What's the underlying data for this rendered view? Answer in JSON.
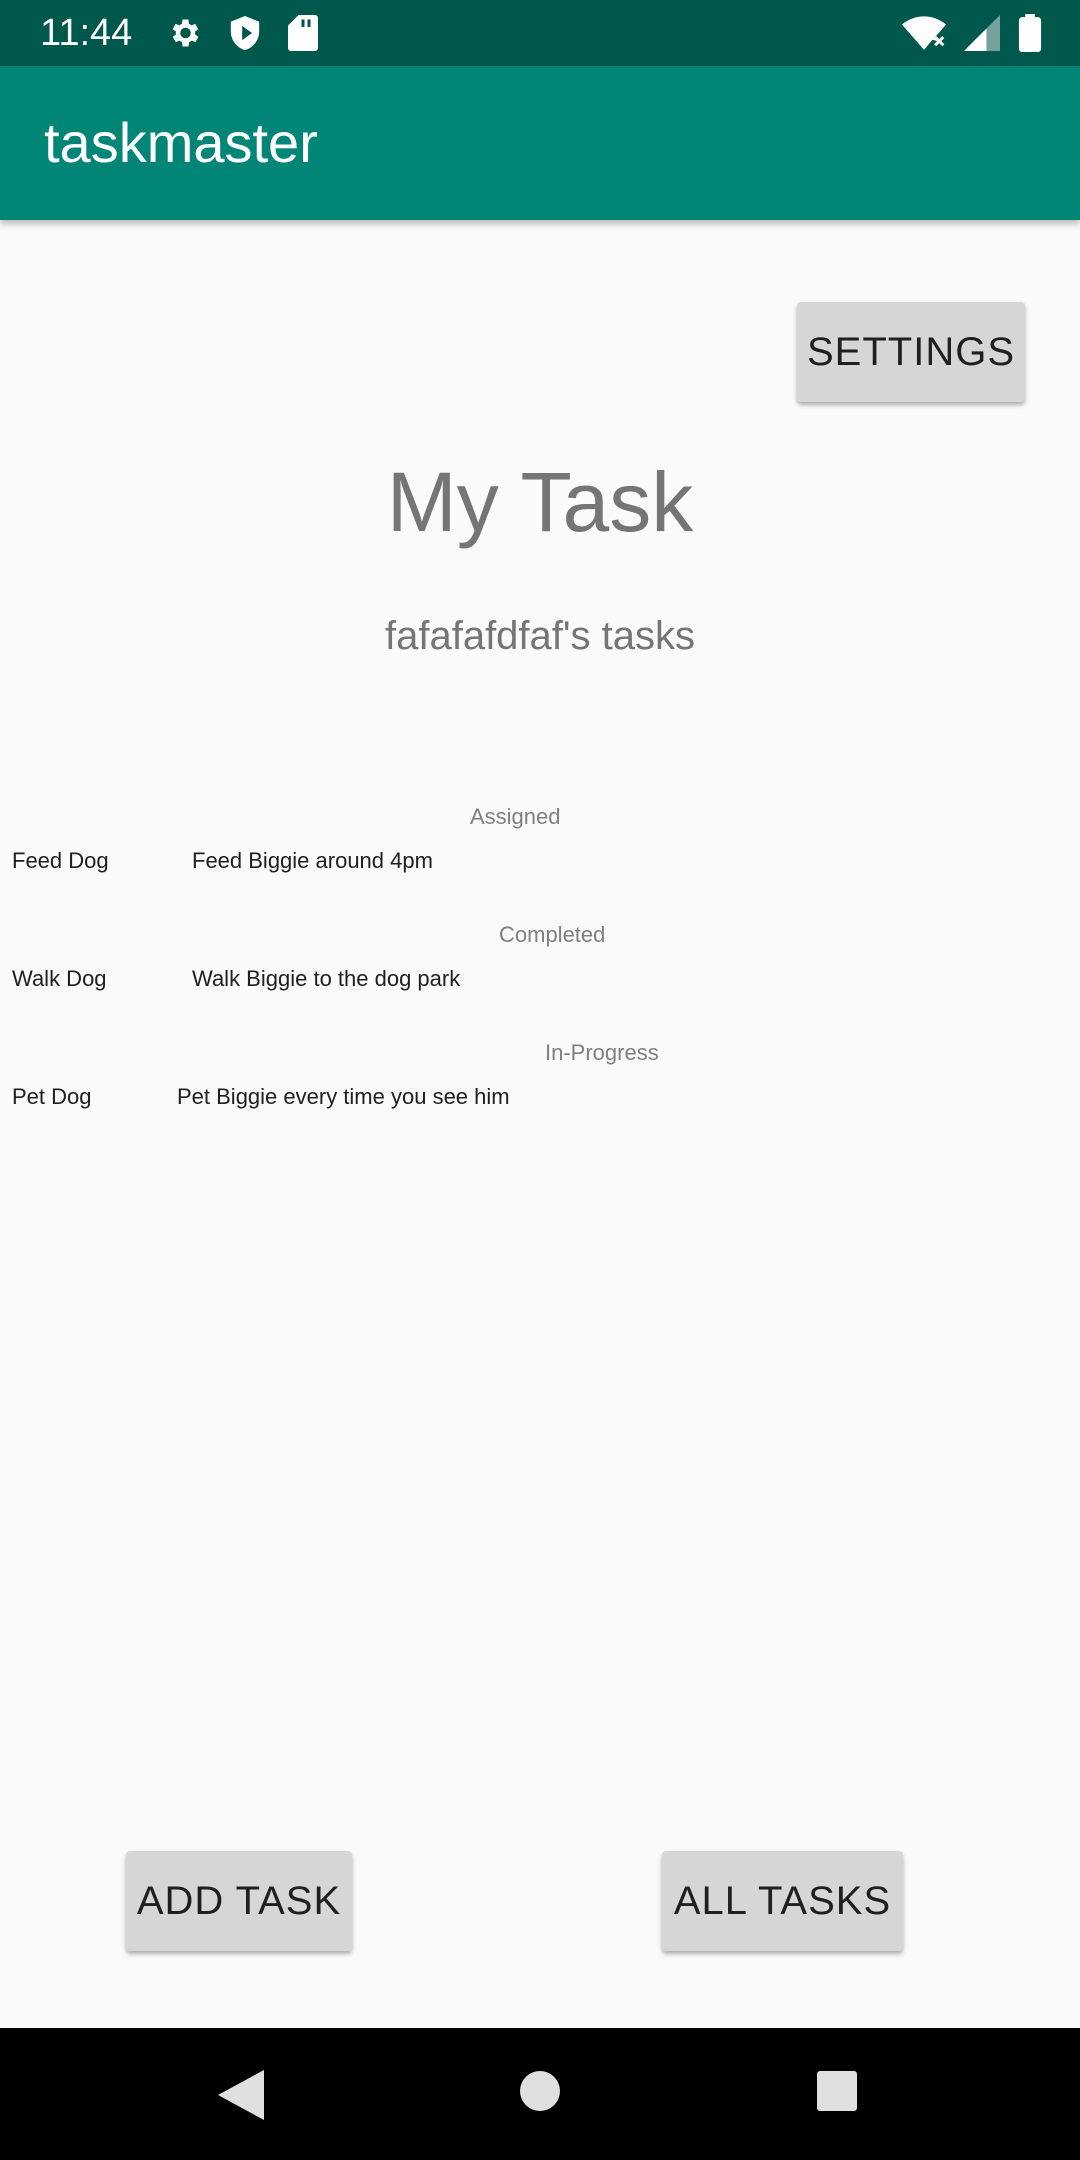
{
  "status_bar": {
    "time": "11:44",
    "icons_left": [
      "gear-icon",
      "shield-icon",
      "sd-card-icon"
    ],
    "icons_right": [
      "wifi-icon",
      "signal-icon",
      "battery-icon"
    ]
  },
  "app_bar": {
    "title": "taskmaster",
    "color": "#008577",
    "status_color": "#00574b"
  },
  "settings_button": {
    "label": "SETTINGS"
  },
  "main": {
    "title": "My Task",
    "subtitle": "fafafafdfaf's tasks"
  },
  "tasks": [
    {
      "status": "Assigned",
      "name": "Feed Dog",
      "description": "Feed Biggie around 4pm"
    },
    {
      "status": "Completed",
      "name": "Walk Dog",
      "description": "Walk Biggie to the dog park"
    },
    {
      "status": "In-Progress",
      "name": "Pet Dog",
      "description": "Pet Biggie every time you see him"
    }
  ],
  "buttons": {
    "add_task": "ADD TASK",
    "all_tasks": "ALL TASKS"
  },
  "nav_bar": {
    "icons": [
      "back-icon",
      "home-icon",
      "recents-icon"
    ]
  }
}
